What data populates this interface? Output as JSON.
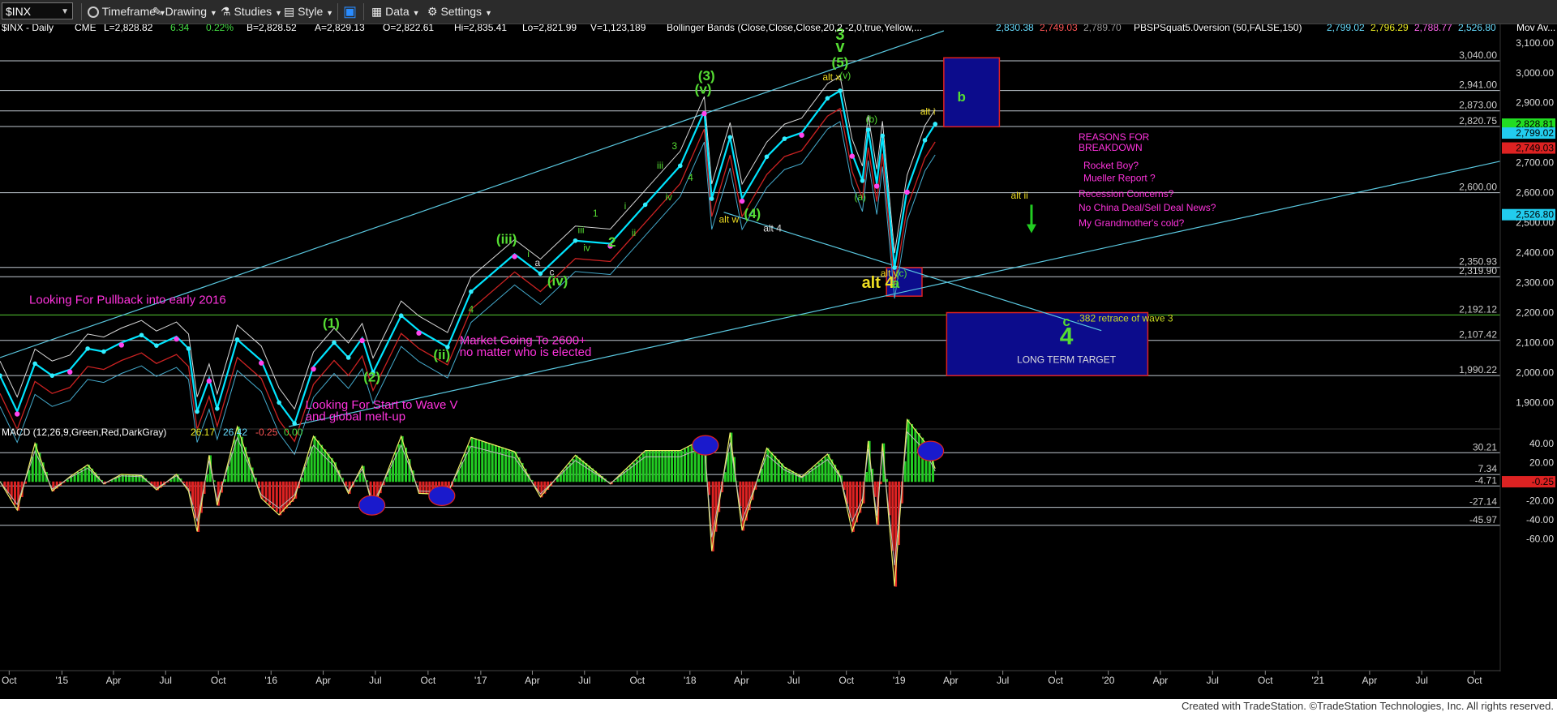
{
  "toolbar": {
    "symbol": "$INX",
    "timeframe": "Timeframe",
    "drawing": "Drawing",
    "studies": "Studies",
    "style": "Style",
    "data": "Data",
    "settings": "Settings"
  },
  "colors": {
    "background": "#000000",
    "price_line": "#00e5ff",
    "label_green": "#55dd33",
    "label_yellow": "#eedd22",
    "label_magenta": "#ff33dd",
    "target_box": "#0c0c8c",
    "target_border": "#dd2222",
    "macd_pos": "#22cc22",
    "macd_neg": "#dd2222"
  },
  "chart_data": {
    "type": "line",
    "title": "$INX - Daily",
    "header": {
      "name": "$INX - Daily",
      "exchange": "CME",
      "last": "L=2,828.82",
      "change": "6.34",
      "pct": "0.22%",
      "bid": "B=2,828.52",
      "ask": "A=2,829.13",
      "open": "O=2,822.61",
      "high": "Hi=2,835.41",
      "low": "Lo=2,821.99",
      "volume": "V=1,123,189",
      "bb_label": "Bollinger Bands (Close,Close,Close,20,2,-2,0,true,Yellow,...",
      "bb_v1": "2,830.38",
      "bb_v2": "2,749.03",
      "bb_v3": "2,789.70",
      "pbs_label": "PBSPSquat5.0version (50,FALSE,150)",
      "pbs_v1": "2,799.02",
      "pbs_v2": "2,796.29",
      "pbs_v3": "2,788.77",
      "pbs_v4": "2,526.80",
      "mov_label": "Mov Av..."
    },
    "y_ticks": [
      "3,100.00",
      "3,000.00",
      "2,900.00",
      "2,800.00",
      "2,700.00",
      "2,600.00",
      "2,500.00",
      "2,400.00",
      "2,300.00",
      "2,200.00",
      "2,100.00",
      "2,000.00",
      "1,900.00"
    ],
    "ylim": [
      1820,
      3140
    ],
    "levels": [
      {
        "v": 3040.0,
        "label": "3,040.00"
      },
      {
        "v": 2941.0,
        "label": "2,941.00"
      },
      {
        "v": 2873.0,
        "label": "2,873.00"
      },
      {
        "v": 2820.75,
        "label": "2,820.75"
      },
      {
        "v": 2600.0,
        "label": "2,600.00"
      },
      {
        "v": 2350.93,
        "label": "2,350.93"
      },
      {
        "v": 2319.9,
        "label": "2,319.90"
      },
      {
        "v": 2192.12,
        "label": "2,192.12"
      },
      {
        "v": 2107.42,
        "label": "2,107.42"
      },
      {
        "v": 1990.22,
        "label": "1,990.22"
      }
    ],
    "price_badges": [
      {
        "v": 2828.81,
        "label": "2,828.81",
        "color": "#22dd22"
      },
      {
        "v": 2799.02,
        "label": "2,799.02",
        "color": "#22ccee"
      },
      {
        "v": 2749.03,
        "label": "2,749.03",
        "color": "#dd2222"
      },
      {
        "v": 2526.8,
        "label": "2,526.80",
        "color": "#22ccee"
      }
    ],
    "x_ticks": [
      "Oct",
      "'15",
      "Apr",
      "Jul",
      "Oct",
      "'16",
      "Apr",
      "Jul",
      "Oct",
      "'17",
      "Apr",
      "Jul",
      "Oct",
      "'18",
      "Apr",
      "Jul",
      "Oct",
      "'19",
      "Apr",
      "Jul",
      "Oct",
      "'20",
      "Apr",
      "Jul",
      "Oct",
      "'21",
      "Apr",
      "Jul",
      "Oct"
    ],
    "x_start": "2014-09-15",
    "x_end": "2021-11-15",
    "series": [
      {
        "name": "$INX close",
        "points": [
          [
            "2014-09-15",
            1990
          ],
          [
            "2014-10-15",
            1870
          ],
          [
            "2014-11-15",
            2030
          ],
          [
            "2014-12-15",
            1990
          ],
          [
            "2015-01-15",
            2010
          ],
          [
            "2015-02-15",
            2080
          ],
          [
            "2015-03-15",
            2070
          ],
          [
            "2015-04-15",
            2100
          ],
          [
            "2015-05-20",
            2125
          ],
          [
            "2015-06-15",
            2090
          ],
          [
            "2015-07-20",
            2120
          ],
          [
            "2015-08-10",
            2080
          ],
          [
            "2015-08-25",
            1870
          ],
          [
            "2015-09-15",
            1980
          ],
          [
            "2015-09-29",
            1880
          ],
          [
            "2015-11-03",
            2110
          ],
          [
            "2015-12-15",
            2040
          ],
          [
            "2016-01-15",
            1900
          ],
          [
            "2016-02-11",
            1830
          ],
          [
            "2016-03-15",
            2020
          ],
          [
            "2016-04-20",
            2100
          ],
          [
            "2016-05-15",
            2050
          ],
          [
            "2016-06-08",
            2115
          ],
          [
            "2016-06-27",
            2000
          ],
          [
            "2016-08-15",
            2190
          ],
          [
            "2016-09-15",
            2140
          ],
          [
            "2016-11-04",
            2085
          ],
          [
            "2016-12-15",
            2270
          ],
          [
            "2017-03-01",
            2395
          ],
          [
            "2017-04-15",
            2330
          ],
          [
            "2017-06-15",
            2440
          ],
          [
            "2017-08-15",
            2430
          ],
          [
            "2017-10-15",
            2560
          ],
          [
            "2017-12-15",
            2690
          ],
          [
            "2018-01-26",
            2872
          ],
          [
            "2018-02-08",
            2580
          ],
          [
            "2018-03-12",
            2785
          ],
          [
            "2018-04-02",
            2580
          ],
          [
            "2018-05-15",
            2720
          ],
          [
            "2018-06-15",
            2780
          ],
          [
            "2018-07-15",
            2800
          ],
          [
            "2018-08-29",
            2915
          ],
          [
            "2018-09-20",
            2940
          ],
          [
            "2018-10-11",
            2730
          ],
          [
            "2018-10-29",
            2640
          ],
          [
            "2018-11-08",
            2810
          ],
          [
            "2018-11-23",
            2630
          ],
          [
            "2018-12-03",
            2790
          ],
          [
            "2018-12-24",
            2350
          ],
          [
            "2019-01-15",
            2610
          ],
          [
            "2019-02-15",
            2775
          ],
          [
            "2019-03-05",
            2829
          ]
        ]
      }
    ],
    "annotations": [
      {
        "text": "3",
        "color": "green",
        "date": "2018-09-20",
        "v": 3110,
        "size": "big"
      },
      {
        "text": "v",
        "color": "green",
        "date": "2018-09-20",
        "v": 3070,
        "size": "big"
      },
      {
        "text": "(5)",
        "color": "green",
        "date": "2018-09-20",
        "v": 3020,
        "size": "med"
      },
      {
        "text": "alt x",
        "color": "yellow",
        "date": "2018-09-05",
        "v": 2975,
        "size": "small"
      },
      {
        "text": "(v)",
        "color": "green",
        "date": "2018-09-29",
        "v": 2980,
        "size": "small"
      },
      {
        "text": "(3)",
        "color": "green",
        "date": "2018-01-30",
        "v": 2975,
        "size": "med"
      },
      {
        "text": "(v)",
        "color": "green",
        "date": "2018-01-24",
        "v": 2930,
        "size": "med"
      },
      {
        "text": "b",
        "color": "green",
        "date": "2019-04-20",
        "v": 2905,
        "size": "med"
      },
      {
        "text": "alt i",
        "color": "yellow",
        "date": "2019-02-20",
        "v": 2860,
        "size": "small"
      },
      {
        "text": "(b)",
        "color": "green",
        "date": "2018-11-14",
        "v": 2835,
        "size": "small"
      },
      {
        "text": "3",
        "color": "green",
        "date": "2017-12-05",
        "v": 2745,
        "size": "small"
      },
      {
        "text": "iii",
        "color": "green",
        "date": "2017-11-10",
        "v": 2680,
        "size": "small"
      },
      {
        "text": "4",
        "color": "green",
        "date": "2018-01-02",
        "v": 2640,
        "size": "small"
      },
      {
        "text": "iv",
        "color": "green",
        "date": "2017-11-25",
        "v": 2575,
        "size": "small"
      },
      {
        "text": "(a)",
        "color": "green",
        "date": "2018-10-25",
        "v": 2575,
        "size": "small"
      },
      {
        "text": "(4)",
        "color": "green",
        "date": "2018-04-20",
        "v": 2515,
        "size": "med"
      },
      {
        "text": "alt w",
        "color": "yellow",
        "date": "2018-03-10",
        "v": 2500,
        "size": "small"
      },
      {
        "text": "alt ii",
        "color": "yellow",
        "date": "2019-07-30",
        "v": 2580,
        "size": "small"
      },
      {
        "text": "alt 4",
        "color": "white",
        "date": "2018-05-25",
        "v": 2470,
        "size": "small"
      },
      {
        "text": "1",
        "color": "green",
        "date": "2017-07-20",
        "v": 2520,
        "size": "small"
      },
      {
        "text": "i",
        "color": "green",
        "date": "2017-09-10",
        "v": 2545,
        "size": "small"
      },
      {
        "text": "ii",
        "color": "green",
        "date": "2017-09-25",
        "v": 2455,
        "size": "small"
      },
      {
        "text": "2",
        "color": "green",
        "date": "2017-08-18",
        "v": 2420,
        "size": "med"
      },
      {
        "text": "(iii)",
        "color": "green",
        "date": "2017-02-15",
        "v": 2430,
        "size": "med"
      },
      {
        "text": "iii",
        "color": "green",
        "date": "2017-06-25",
        "v": 2465,
        "size": "small"
      },
      {
        "text": "iv",
        "color": "green",
        "date": "2017-07-05",
        "v": 2405,
        "size": "small"
      },
      {
        "text": "i",
        "color": "green",
        "date": "2017-03-25",
        "v": 2385,
        "size": "small"
      },
      {
        "text": "a",
        "color": "white",
        "date": "2017-04-10",
        "v": 2355,
        "size": "small"
      },
      {
        "text": "c",
        "color": "white",
        "date": "2017-05-05",
        "v": 2325,
        "size": "small"
      },
      {
        "text": "(iv)",
        "color": "green",
        "date": "2017-05-15",
        "v": 2290,
        "size": "med"
      },
      {
        "text": "alt y",
        "color": "yellow",
        "date": "2018-12-15",
        "v": 2320,
        "size": "small"
      },
      {
        "text": "(c)",
        "color": "green",
        "date": "2019-01-05",
        "v": 2320,
        "size": "small"
      },
      {
        "text": "alt 4",
        "color": "yellow",
        "date": "2018-11-25",
        "v": 2282,
        "size": "big"
      },
      {
        "text": "a",
        "color": "green",
        "date": "2018-12-26",
        "v": 2282,
        "size": "med"
      },
      {
        "text": "c",
        "color": "green",
        "date": "2019-10-20",
        "v": 2155,
        "size": "med"
      },
      {
        "text": "4",
        "color": "green",
        "date": "2019-10-20",
        "v": 2095,
        "size": "huge"
      },
      {
        "text": "(1)",
        "color": "green",
        "date": "2016-04-15",
        "v": 2150,
        "size": "med"
      },
      {
        "text": "(2)",
        "color": "green",
        "date": "2016-06-25",
        "v": 1970,
        "size": "med"
      },
      {
        "text": "(ii)",
        "color": "green",
        "date": "2016-10-25",
        "v": 2045,
        "size": "med"
      },
      {
        "text": "4",
        "color": "green",
        "date": "2016-12-15",
        "v": 2200,
        "size": "small"
      }
    ],
    "notes": [
      {
        "text": "Looking For Pullback into early 2016",
        "color": "magenta",
        "date": "2014-11-05",
        "v": 2230
      },
      {
        "text": "Market Going To 2600+",
        "color": "magenta",
        "date": "2016-11-25",
        "v": 2095
      },
      {
        "text": "no matter who is elected",
        "color": "magenta",
        "date": "2016-11-25",
        "v": 2055
      },
      {
        "text": "Looking For Start to Wave V",
        "color": "magenta",
        "date": "2016-03-01",
        "v": 1880
      },
      {
        "text": "and global melt-up",
        "color": "magenta",
        "date": "2016-03-01",
        "v": 1840
      },
      {
        "text": ".382 retrace of wave 3",
        "color": "yellowgreen",
        "date": "2020-01-30",
        "v": 2170
      },
      {
        "text": "LONG TERM TARGET",
        "color": "white",
        "date": "2019-10-20",
        "v": 2032
      }
    ],
    "reasons": {
      "title1": "REASONS FOR",
      "title2": "BREAKDOWN",
      "items": [
        "Rocket Boy?",
        "Mueller Report ?",
        "Recession Concerns?",
        "No China Deal/Sell Deal News?",
        "My Grandmother's cold?"
      ]
    },
    "boxes": [
      {
        "name": "b-target-box",
        "x0": "2019-03-20",
        "x1": "2019-06-25",
        "v0": 2820,
        "v1": 3050
      },
      {
        "name": "alt4-box",
        "x0": "2018-12-10",
        "x1": "2019-02-10",
        "v0": 2255,
        "v1": 2350
      },
      {
        "name": "long-term-target-box",
        "x0": "2019-03-25",
        "x1": "2020-03-10",
        "v0": 1990,
        "v1": 2200
      }
    ],
    "trendlines": [
      {
        "x0": "2014-09-15",
        "v0": 2050,
        "x1": "2019-03-20",
        "v1": 3140
      },
      {
        "x0": "2016-02-01",
        "v0": 1820,
        "x1": "2021-11-15",
        "v1": 2705
      },
      {
        "x0": "2018-03-01",
        "v0": 2535,
        "x1": "2019-12-20",
        "v1": 2140
      }
    ],
    "macd": {
      "label": "MACD (12,26,9,Green,Red,DarkGray)",
      "v1": "26.17",
      "v2": "26.42",
      "v3": "-0.25",
      "v4": "0.00",
      "ylim": [
        -70,
        50
      ],
      "y_ticks": [
        "40.00",
        "20.00",
        "-20.00",
        "-40.00",
        "-60.00"
      ],
      "levels": [
        {
          "v": 30.21,
          "label": "30.21"
        },
        {
          "v": 7.34,
          "label": "7.34"
        },
        {
          "v": -4.71,
          "label": "-4.71"
        },
        {
          "v": -27.14,
          "label": "-27.14"
        },
        {
          "v": -45.97,
          "label": "-45.97"
        }
      ],
      "badge": "-0.25"
    }
  },
  "footer": "Created with TradeStation. ©TradeStation Technologies, Inc. All rights reserved."
}
